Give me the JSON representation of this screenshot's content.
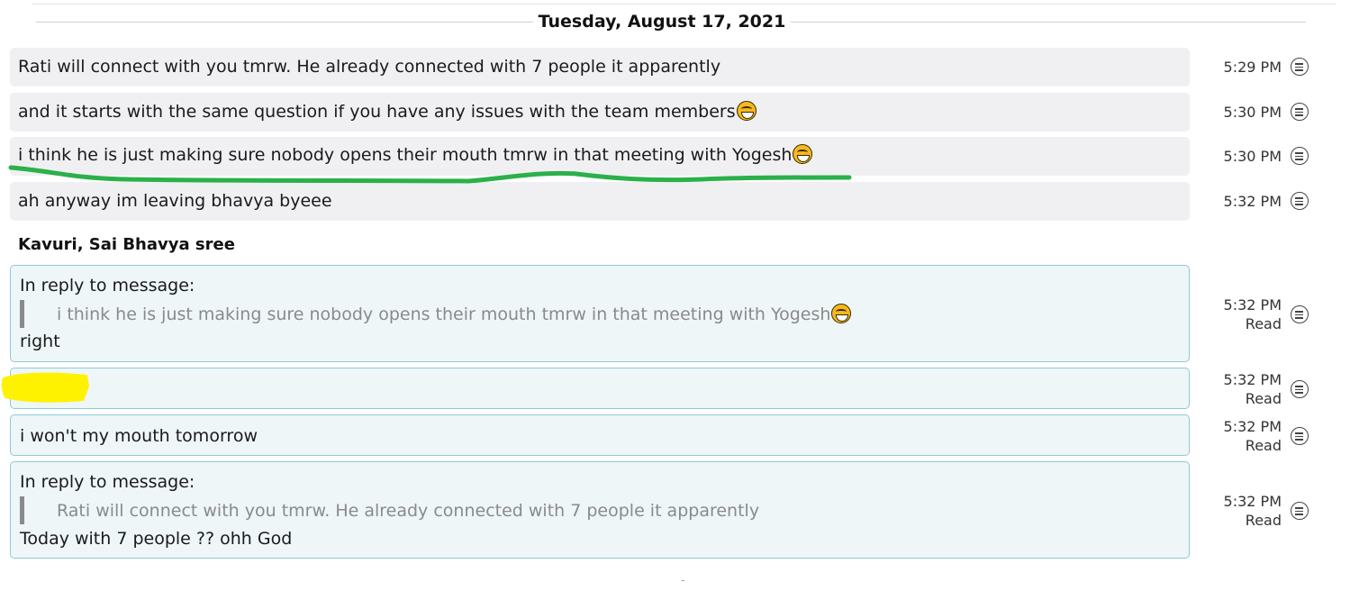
{
  "date_separator": "Tuesday, August 17, 2021",
  "messages_incoming": [
    {
      "text": "Rati will connect with you tmrw. He already connected with 7 people it apparently",
      "time": "5:29 PM",
      "emoji": false
    },
    {
      "text": "and it starts with the same question if you have any issues with the team members",
      "time": "5:30 PM",
      "emoji": true,
      "emoji_icon": "rolling-laughing-icon"
    },
    {
      "text": "i think he is just making sure nobody opens their mouth tmrw in that meeting with Yogesh",
      "time": "5:30 PM",
      "emoji": true,
      "emoji_icon": "joy-icon"
    },
    {
      "text": "ah anyway im leaving bhavya byeee",
      "time": "5:32 PM",
      "emoji": false
    }
  ],
  "sender_name": "Kavuri, Sai Bhavya sree",
  "messages_outgoing": [
    {
      "reply_header": "In reply to message:",
      "quote": "i think he is just making sure nobody opens their mouth tmrw in that meeting with Yogesh",
      "quote_emoji": "joy-icon",
      "text": "right",
      "time": "5:32 PM",
      "status": "Read"
    },
    {
      "text": "",
      "time": "5:32 PM",
      "status": "Read",
      "redacted": true
    },
    {
      "text": "i won't my mouth tomorrow",
      "time": "5:32 PM",
      "status": "Read"
    },
    {
      "reply_header": "In reply to message:",
      "quote": "Rati will connect with you tmrw. He already connected with 7 people it apparently",
      "text": "Today with 7 people ?? ohh God",
      "time": "5:32 PM",
      "status": "Read"
    }
  ],
  "icons": {
    "message_menu": "message-options-icon"
  },
  "colors": {
    "incoming_bg": "#f0f0f2",
    "outgoing_bg": "#eef6f8",
    "outgoing_border": "#8ccad6",
    "underline_annotation": "#2bb04a",
    "redaction_highlight": "#fff200"
  }
}
